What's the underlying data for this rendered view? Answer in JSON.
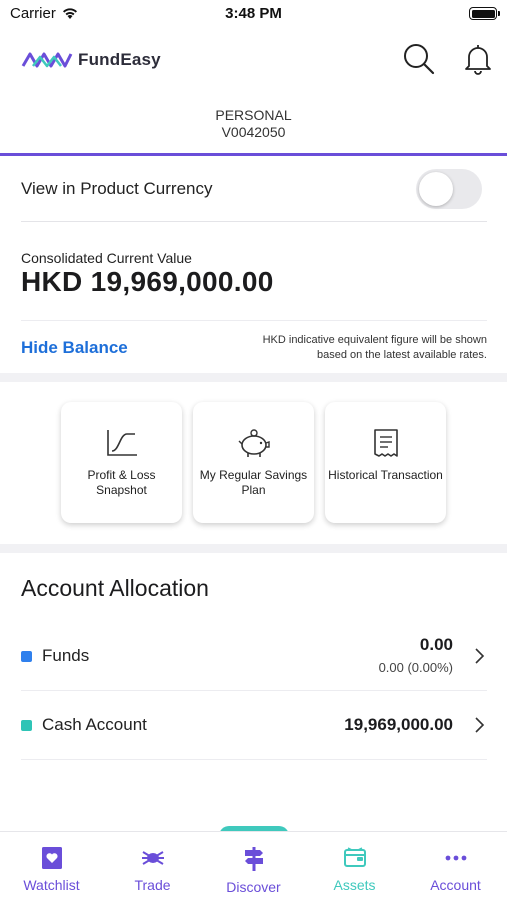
{
  "status_bar": {
    "carrier": "Carrier",
    "time": "3:48 PM"
  },
  "header": {
    "app_name": "FundEasy",
    "logo_color": "#6a4ed9"
  },
  "account": {
    "type": "PERSONAL",
    "number": "V0042050"
  },
  "currency_toggle": {
    "label": "View in Product Currency",
    "enabled": false
  },
  "balance": {
    "label": "Consolidated Current Value",
    "value": "HKD 19,969,000.00",
    "hide_label": "Hide Balance",
    "note": "HKD indicative equivalent figure will be shown based on the latest available rates."
  },
  "shortcuts": [
    {
      "label": "Profit & Loss Snapshot",
      "icon": "chart-curve-icon"
    },
    {
      "label": "My Regular Savings Plan",
      "icon": "piggy-bank-icon"
    },
    {
      "label": "Historical Transaction",
      "icon": "receipt-icon"
    }
  ],
  "allocation": {
    "title": "Account Allocation",
    "rows": [
      {
        "name": "Funds",
        "amount": "0.00",
        "sub": "0.00 (0.00%)",
        "color": "#2f80ed"
      },
      {
        "name": "Cash Account",
        "amount": "19,969,000.00",
        "sub": "",
        "color": "#2ec4b6"
      }
    ]
  },
  "tabs": [
    {
      "label": "Watchlist",
      "icon": "heart-card-icon",
      "active": false
    },
    {
      "label": "Trade",
      "icon": "bug-trade-icon",
      "active": false
    },
    {
      "label": "Discover",
      "icon": "signpost-icon",
      "active": false
    },
    {
      "label": "Assets",
      "icon": "wallet-icon",
      "active": true
    },
    {
      "label": "Account",
      "icon": "more-dots-icon",
      "active": false
    }
  ],
  "colors": {
    "accent": "#6a4ed9",
    "active_tab": "#3fc9bd",
    "link": "#1e6fd9"
  }
}
